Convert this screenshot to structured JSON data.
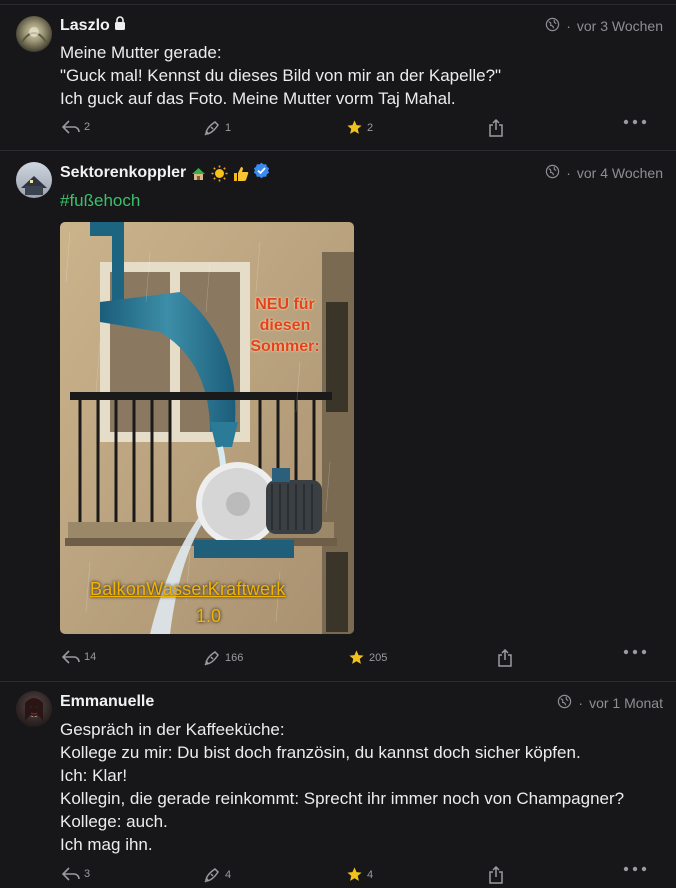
{
  "posts": [
    {
      "author": "Laszlo",
      "time": "vor 3 Wochen",
      "dot": "·",
      "lines": [
        "Meine Mutter gerade:",
        "\"Guck mal! Kennst du dieses Bild von mir an der Kapelle?\"",
        "Ich guck auf das Foto. Meine Mutter vorm Taj Mahal."
      ],
      "replies": "2",
      "boosts": "1",
      "favs": "2"
    },
    {
      "author": "Sektorenkoppler",
      "time": "vor 4 Wochen",
      "dot": "·",
      "hashtag": "#fußehoch",
      "image_text": {
        "top": [
          "NEU für",
          "diesen",
          "Sommer:"
        ],
        "bottom": "BalkonWasserKraftwerk",
        "version": "1.0"
      },
      "replies": "14",
      "boosts": "166",
      "favs": "205"
    },
    {
      "author": "Emmanuelle",
      "time": "vor 1 Monat",
      "dot": "·",
      "lines": [
        "Gespräch in der Kaffeeküche:",
        "Kollege zu mir: Du bist doch französin, du kannst doch sicher köpfen.",
        "Ich: Klar!",
        "Kollegin, die gerade reinkommt: Sprecht ihr immer noch von Champagner?",
        "Kollege: auch.",
        "Ich mag ihn."
      ],
      "replies": "3",
      "boosts": "4",
      "favs": "4"
    }
  ],
  "colors": {
    "background": "#17171a",
    "hashtag": "#3ac06a",
    "star": "#f2c21b",
    "muted": "#8e8e93",
    "verified": "#3a8bf0"
  },
  "icons": {
    "lock": "lock-icon",
    "globe": "globe-icon",
    "reply": "reply-icon",
    "boost": "boost-icon",
    "favourite": "star-icon",
    "share": "share-icon",
    "more": "more-icon",
    "verified": "verified-badge-icon"
  }
}
